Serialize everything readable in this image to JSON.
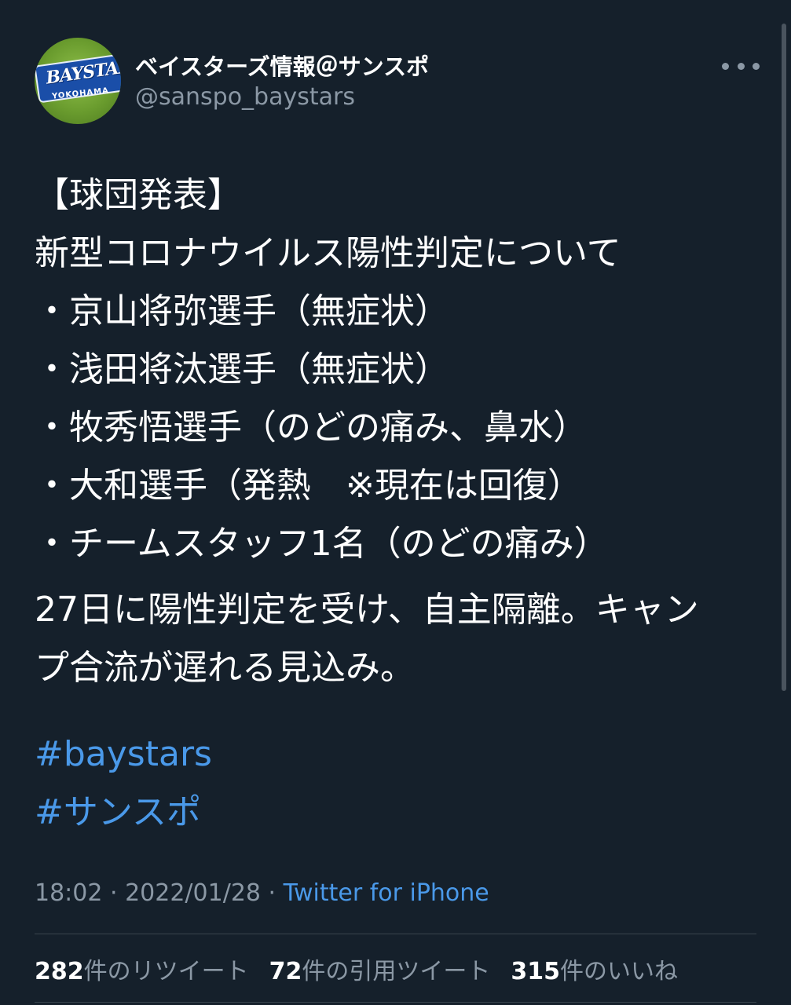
{
  "user": {
    "display_name": "ベイスターズ情報＠サンスポ",
    "handle": "@sanspo_baystars",
    "avatar_text": "BAYSTARS",
    "avatar_sub": "YOKOHAMA"
  },
  "tweet": {
    "lines_para1": [
      "【球団発表】",
      "新型コロナウイルス陽性判定について",
      "・京山将弥選手（無症状）",
      "・浅田将汰選手（無症状）",
      "・牧秀悟選手（のどの痛み、鼻水）",
      "・大和選手（発熱　※現在は回復）",
      "・チームスタッフ1名（のどの痛み）"
    ],
    "lines_para2": [
      "27日に陽性判定を受け、自主隔離。キャン",
      "プ合流が遅れる見込み。"
    ],
    "hashtags": [
      "#baystars",
      "#サンスポ"
    ]
  },
  "meta": {
    "time": "18:02",
    "sep": " · ",
    "date": "2022/01/28",
    "source": "Twitter for iPhone"
  },
  "stats": {
    "retweets_count": "282",
    "retweets_label": "件のリツイート",
    "quotes_count": "72",
    "quotes_label": "件の引用ツイート",
    "likes_count": "315",
    "likes_label": "件のいいね"
  },
  "colors": {
    "background": "#15202b",
    "link": "#4a99e9",
    "secondary_text": "#8b98a5"
  }
}
